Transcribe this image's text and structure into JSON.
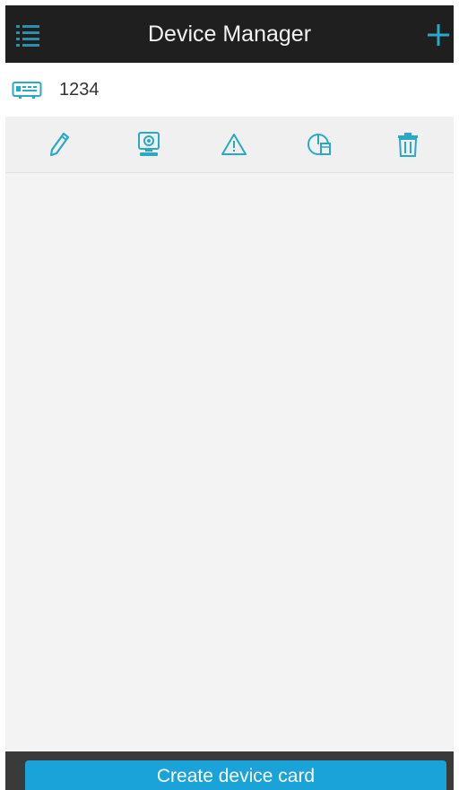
{
  "header": {
    "title": "Device Manager",
    "menu_icon": "list-menu-icon",
    "add_icon": "plus-icon"
  },
  "devices": [
    {
      "name": "1234",
      "icon": "device-card-icon"
    }
  ],
  "actions": [
    {
      "icon": "edit-pencil-icon"
    },
    {
      "icon": "camera-icon"
    },
    {
      "icon": "alarm-warning-icon"
    },
    {
      "icon": "status-pie-icon"
    },
    {
      "icon": "trash-icon"
    }
  ],
  "footer": {
    "create_label": "Create device card"
  },
  "colors": {
    "accent": "#2aa8c8",
    "topbar": "#1f1f1f",
    "button": "#1aa3d9"
  }
}
